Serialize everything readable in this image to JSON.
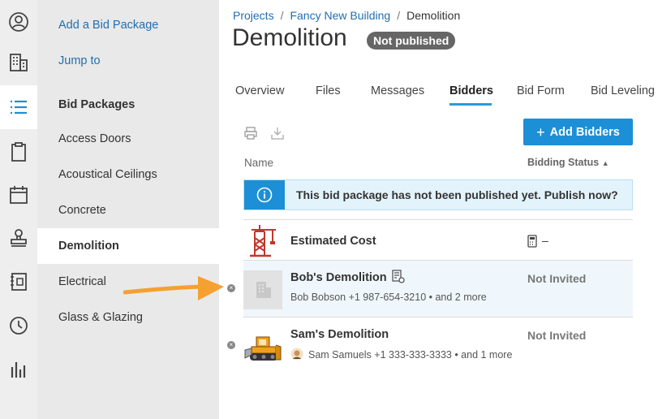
{
  "sidebar": {
    "add_link": "Add a Bid Package",
    "jump_link": "Jump to",
    "heading": "Bid Packages",
    "items": [
      {
        "label": "Access Doors"
      },
      {
        "label": "Acoustical Ceilings"
      },
      {
        "label": "Concrete"
      },
      {
        "label": "Demolition",
        "active": true
      },
      {
        "label": "Electrical"
      },
      {
        "label": "Glass & Glazing"
      }
    ]
  },
  "rail_icons": [
    "user-icon",
    "building-icon",
    "list-icon",
    "clipboard-icon",
    "calendar-icon",
    "stamp-icon",
    "notebook-icon",
    "clock-icon",
    "bar-chart-icon"
  ],
  "breadcrumb": {
    "root": "Projects",
    "project": "Fancy New Building",
    "current": "Demolition"
  },
  "title": "Demolition",
  "status_badge": "Not published",
  "tabs": [
    "Overview",
    "Files",
    "Messages",
    "Bidders",
    "Bid Form",
    "Bid Leveling"
  ],
  "active_tab": "Bidders",
  "add_bidders": "Add Bidders",
  "columns": {
    "name": "Name",
    "status": "Bidding Status"
  },
  "banner": "This bid package has not been published yet. Publish now?",
  "estimated_cost": {
    "label": "Estimated Cost",
    "value": "–"
  },
  "bidders": [
    {
      "name": "Bob's Demolition",
      "contact": "Bob Bobson +1 987-654-3210 • and 2 more",
      "status": "Not Invited"
    },
    {
      "name": "Sam's Demolition",
      "contact": "Sam Samuels +1 333-333-3333 • and 1 more",
      "status": "Not Invited"
    }
  ],
  "colors": {
    "accent": "#1d8fd6",
    "link": "#1f6fb0",
    "badge": "#666666",
    "arrow": "#f5a030"
  }
}
